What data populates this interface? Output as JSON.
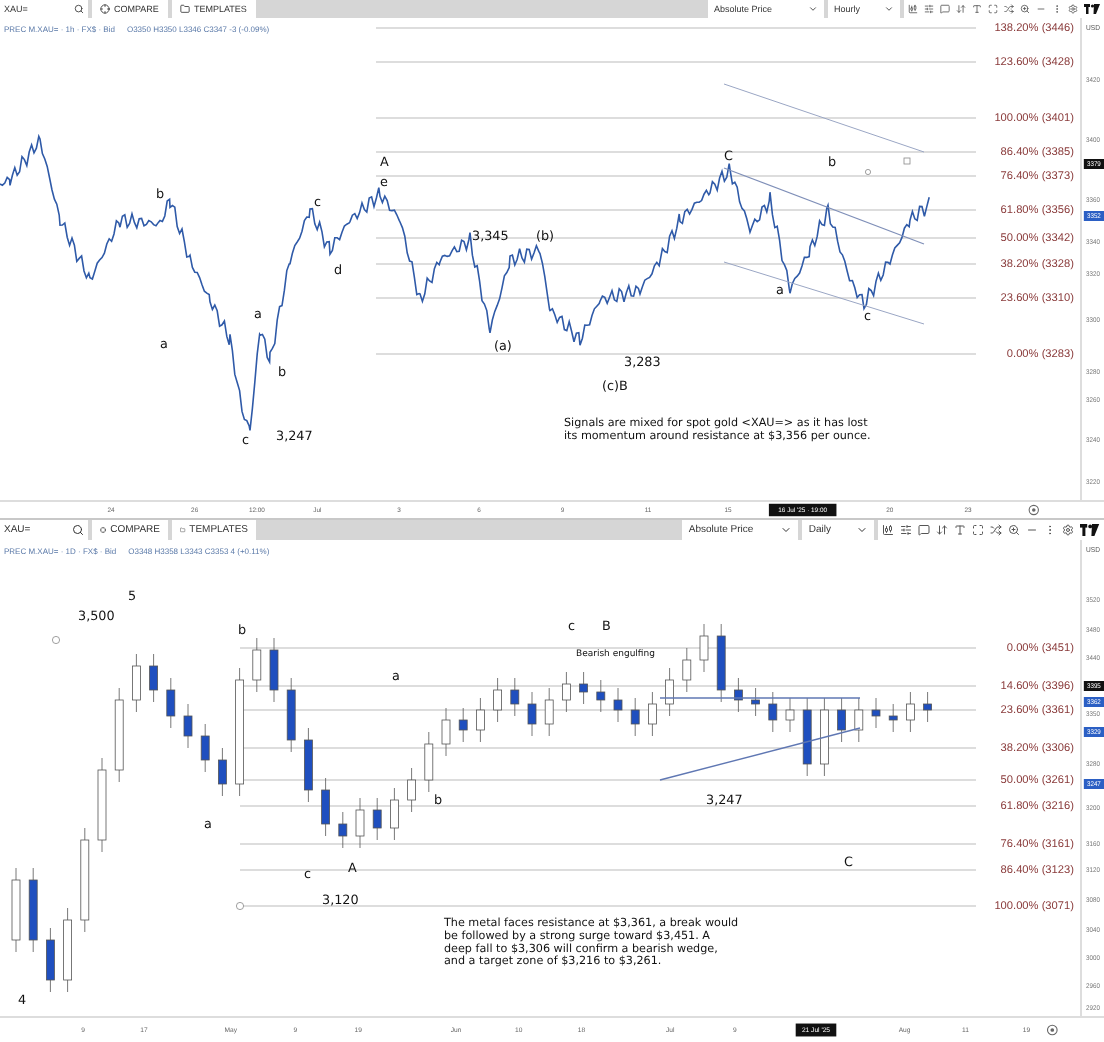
{
  "panels": [
    {
      "toolbar": {
        "symbol": "XAU=",
        "compare": "COMPARE",
        "templates": "TEMPLATES",
        "price_mode": "Absolute Price",
        "interval": "Hourly"
      },
      "legend": {
        "instrument": "PREC M.XAU= · 1h · FX$ · Bid",
        "ohlc": "O3350 H3350 L3346 C3347 -3 (-0.09%)"
      },
      "fib_levels": [
        "138.20% (3446)",
        "123.60% (3428)",
        "100.00% (3401)",
        "86.40% (3385)",
        "76.40% (3373)",
        "61.80% (3356)",
        "50.00% (3342)",
        "38.20% (3328)",
        "23.60% (3310)",
        "0.00% (3283)"
      ],
      "annotations": [
        {
          "text": "A",
          "kind": "wave"
        },
        {
          "text": "e",
          "kind": "wave"
        },
        {
          "text": "C",
          "kind": "wave"
        },
        {
          "text": "b",
          "kind": "wave"
        },
        {
          "text": "b",
          "kind": "wave"
        },
        {
          "text": "c",
          "kind": "wave"
        },
        {
          "text": "3,345",
          "kind": "wave"
        },
        {
          "text": "(b)",
          "kind": "wave"
        },
        {
          "text": "d",
          "kind": "wave"
        },
        {
          "text": "a",
          "kind": "wave"
        },
        {
          "text": "c",
          "kind": "wave"
        },
        {
          "text": "a",
          "kind": "wave"
        },
        {
          "text": "a",
          "kind": "wave"
        },
        {
          "text": "b",
          "kind": "wave"
        },
        {
          "text": "(a)",
          "kind": "wave"
        },
        {
          "text": "3,283",
          "kind": "wave"
        },
        {
          "text": "(c)B",
          "kind": "wave"
        },
        {
          "text": "c",
          "kind": "wave"
        },
        {
          "text": "3,247",
          "kind": "wave"
        }
      ],
      "note": [
        "Signals are mixed for spot gold <XAU=> as it has lost",
        "its momentum around resistance at $3,356 per ounce."
      ],
      "price_axis": {
        "currency": "USD",
        "ticks": [
          "3420",
          "3400",
          "3360",
          "3340",
          "3320",
          "3300",
          "3280",
          "3260",
          "3240",
          "3220"
        ],
        "tags": [
          {
            "label": "3379",
            "color": "#111111"
          },
          {
            "label": "3352",
            "color": "#2b5fc4"
          }
        ]
      },
      "time_axis": {
        "ticks": [
          "24",
          "26",
          "12:00",
          "Jul",
          "3",
          "6",
          "9",
          "11",
          "15",
          "20",
          "23"
        ],
        "cursor": "16 Jul '25 · 19:00"
      }
    },
    {
      "toolbar": {
        "symbol": "XAU=",
        "compare": "COMPARE",
        "templates": "TEMPLATES",
        "price_mode": "Absolute Price",
        "interval": "Daily"
      },
      "legend": {
        "instrument": "PREC M.XAU= · 1D · FX$ · Bid",
        "ohlc": "O3348 H3358 L3343 C3353 4 (+0.11%)"
      },
      "fib_levels": [
        "0.00% (3451)",
        "14.60% (3396)",
        "23.60% (3361)",
        "38.20% (3306)",
        "50.00% (3261)",
        "61.80% (3216)",
        "76.40% (3161)",
        "86.40% (3123)",
        "100.00% (3071)"
      ],
      "annotations": [
        {
          "text": "5",
          "kind": "wave"
        },
        {
          "text": "3,500",
          "kind": "wave"
        },
        {
          "text": "b",
          "kind": "wave"
        },
        {
          "text": "c",
          "kind": "wave"
        },
        {
          "text": "B",
          "kind": "wave"
        },
        {
          "text": "Bearish engulfing",
          "kind": "callout"
        },
        {
          "text": "a",
          "kind": "wave"
        },
        {
          "text": "a",
          "kind": "wave"
        },
        {
          "text": "b",
          "kind": "wave"
        },
        {
          "text": "3,247",
          "kind": "wave"
        },
        {
          "text": "c",
          "kind": "wave"
        },
        {
          "text": "A",
          "kind": "wave"
        },
        {
          "text": "3,120",
          "kind": "wave"
        },
        {
          "text": "C",
          "kind": "wave"
        },
        {
          "text": "4",
          "kind": "wave"
        }
      ],
      "note": [
        "The metal faces resistance at $3,361, a break would",
        "be followed by a strong surge toward $3,451.  A",
        "deep fall to $3,306 will confirm a bearish wedge,",
        "and a target zone of $3,216 to $3,261."
      ],
      "price_axis": {
        "currency": "USD",
        "ticks": [
          "3520",
          "3480",
          "3440",
          "3350",
          "3280",
          "3200",
          "3160",
          "3120",
          "3080",
          "3040",
          "3000",
          "2960",
          "2920"
        ],
        "tags": [
          {
            "label": "3395",
            "color": "#111111"
          },
          {
            "label": "3362",
            "color": "#2b5fc4"
          },
          {
            "label": "3329",
            "color": "#2b5fc4"
          },
          {
            "label": "3247",
            "color": "#2b5fc4"
          }
        ]
      },
      "time_axis": {
        "ticks": [
          "9",
          "17",
          "May",
          "9",
          "19",
          "Jun",
          "10",
          "18",
          "Jul",
          "9",
          "Aug",
          "11",
          "19"
        ],
        "cursor": "21 Jul '25"
      }
    }
  ]
}
